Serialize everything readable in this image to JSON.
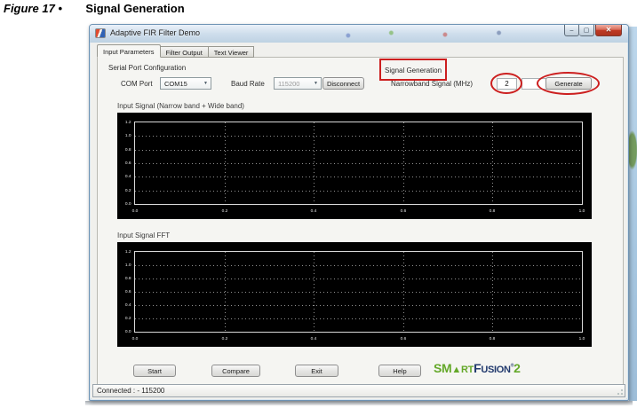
{
  "caption": {
    "prefix": "Figure 17 •",
    "title": "Signal Generation"
  },
  "window": {
    "title": "Adaptive FIR Filter Demo",
    "minimize_glyph": "–",
    "maximize_glyph": "▢",
    "close_glyph": "✕"
  },
  "tabs": [
    {
      "label": "Input Parameters",
      "active": true
    },
    {
      "label": "Filter Output",
      "active": false
    },
    {
      "label": "Text Viewer",
      "active": false
    }
  ],
  "serial": {
    "section_label": "Serial Port Configuration",
    "com_port_label": "COM Port",
    "com_port_value": "COM15",
    "baud_rate_label": "Baud Rate",
    "baud_rate_value": "115200",
    "disconnect_label": "Disconnect"
  },
  "signal_generation": {
    "section_label": "Signal Generation",
    "narrowband_label": "Narrowband Signal (MHz)",
    "narrowband_value": "2",
    "narrowband_input_value": "",
    "generate_label": "Generate"
  },
  "plots": [
    {
      "label": "Input Signal (Narrow band + Wide band)",
      "y_ticks": [
        "1.2",
        "1.0",
        "0.8",
        "0.6",
        "0.4",
        "0.2",
        "0.0"
      ],
      "x_ticks": [
        "0.0",
        "0.2",
        "0.4",
        "0.6",
        "0.8",
        "1.0"
      ]
    },
    {
      "label": "Input Signal FFT",
      "y_ticks": [
        "1.2",
        "1.0",
        "0.8",
        "0.6",
        "0.4",
        "0.2",
        "0.0"
      ],
      "x_ticks": [
        "0.0",
        "0.2",
        "0.4",
        "0.6",
        "0.8",
        "1.0"
      ]
    }
  ],
  "chart_data": [
    {
      "type": "line",
      "title": "Input Signal (Narrow band + Wide band)",
      "xlim": [
        0.0,
        1.0
      ],
      "ylim": [
        0.0,
        1.2
      ],
      "x_tick_labels": [
        0.0,
        0.2,
        0.4,
        0.6,
        0.8,
        1.0
      ],
      "y_tick_labels": [
        0.0,
        0.2,
        0.4,
        0.6,
        0.8,
        1.0,
        1.2
      ],
      "grid": true,
      "series": []
    },
    {
      "type": "line",
      "title": "Input Signal FFT",
      "xlim": [
        0.0,
        1.0
      ],
      "ylim": [
        0.0,
        1.2
      ],
      "x_tick_labels": [
        0.0,
        0.2,
        0.4,
        0.6,
        0.8,
        1.0
      ],
      "y_tick_labels": [
        0.0,
        0.2,
        0.4,
        0.6,
        0.8,
        1.0,
        1.2
      ],
      "grid": true,
      "series": []
    }
  ],
  "footer_buttons": [
    {
      "label": "Start"
    },
    {
      "label": "Compare"
    },
    {
      "label": "Exit"
    },
    {
      "label": "Help"
    }
  ],
  "logo": {
    "green_prefix": "SM",
    "triangle": "▲",
    "green_mid": "RT",
    "navy_f": "F",
    "navy_rest": "USION",
    "reg": "®",
    "suffix": "2"
  },
  "statusbar": {
    "text": "Connected : - 115200"
  },
  "colors": {
    "annotation_red": "#cc1f1f",
    "logo_green": "#64a829",
    "logo_navy": "#223a6e",
    "plot_background": "#000000"
  }
}
